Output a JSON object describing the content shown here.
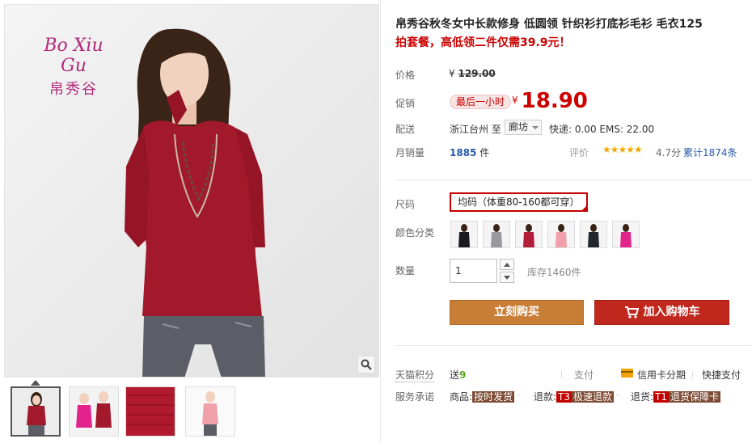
{
  "brand": {
    "latin": "Bo Xiu Gu",
    "cn": "帛秀谷"
  },
  "product": {
    "title": "帛秀谷秋冬女中长款修身 低圆领 针织衫打底衫毛衫 毛衣125",
    "promo": "拍套餐，高低领二件仅需39.9元！"
  },
  "price": {
    "label": "价格",
    "currency": "¥",
    "original": "129.00"
  },
  "promotion": {
    "label": "促销",
    "badge": "最后一小时",
    "currency": "¥",
    "value": "18.90"
  },
  "shipping": {
    "label": "配送",
    "from": "浙江台州  至",
    "to": "廊坊",
    "fee": "快递: 0.00 EMS: 22.00"
  },
  "sales": {
    "label": "月销量",
    "count": "1885",
    "unit": "件",
    "rating_label": "评价",
    "stars": "★★★★★",
    "score": "4.7分",
    "reviews": "累计1874条"
  },
  "options": {
    "size_label": "尺码",
    "size_value": "均码（体重80-160都可穿）",
    "color_label": "颜色分类",
    "colors": [
      "#1b1b1f",
      "#9a9a9e",
      "#b21e3a",
      "#f0a0a8",
      "#22262e",
      "#e2238c"
    ],
    "qty_label": "数量",
    "qty_value": "1",
    "stock": "库存1460件"
  },
  "actions": {
    "buy": "立刻购买",
    "cart": "加入购物车"
  },
  "points": {
    "label": "天猫积分",
    "prefix": "送",
    "value": "9"
  },
  "payment": {
    "label": "支付",
    "credit": "信用卡分期",
    "quick": "快捷支付"
  },
  "service": {
    "label": "服务承诺",
    "goods_prefix": "商品:",
    "goods_tag": "按时发货",
    "refund_prefix": "退款:",
    "refund_code": "T3",
    "refund_tag": "极速退款",
    "return_prefix": "退货:",
    "return_code": "T1",
    "return_tag": "退货保障卡"
  },
  "colors": {
    "accent_red": "#cc0000",
    "buy_button": "#c97e38",
    "cart_button": "#c0281d",
    "link_blue": "#2a5aa8",
    "brand_purple": "#b0297a"
  }
}
